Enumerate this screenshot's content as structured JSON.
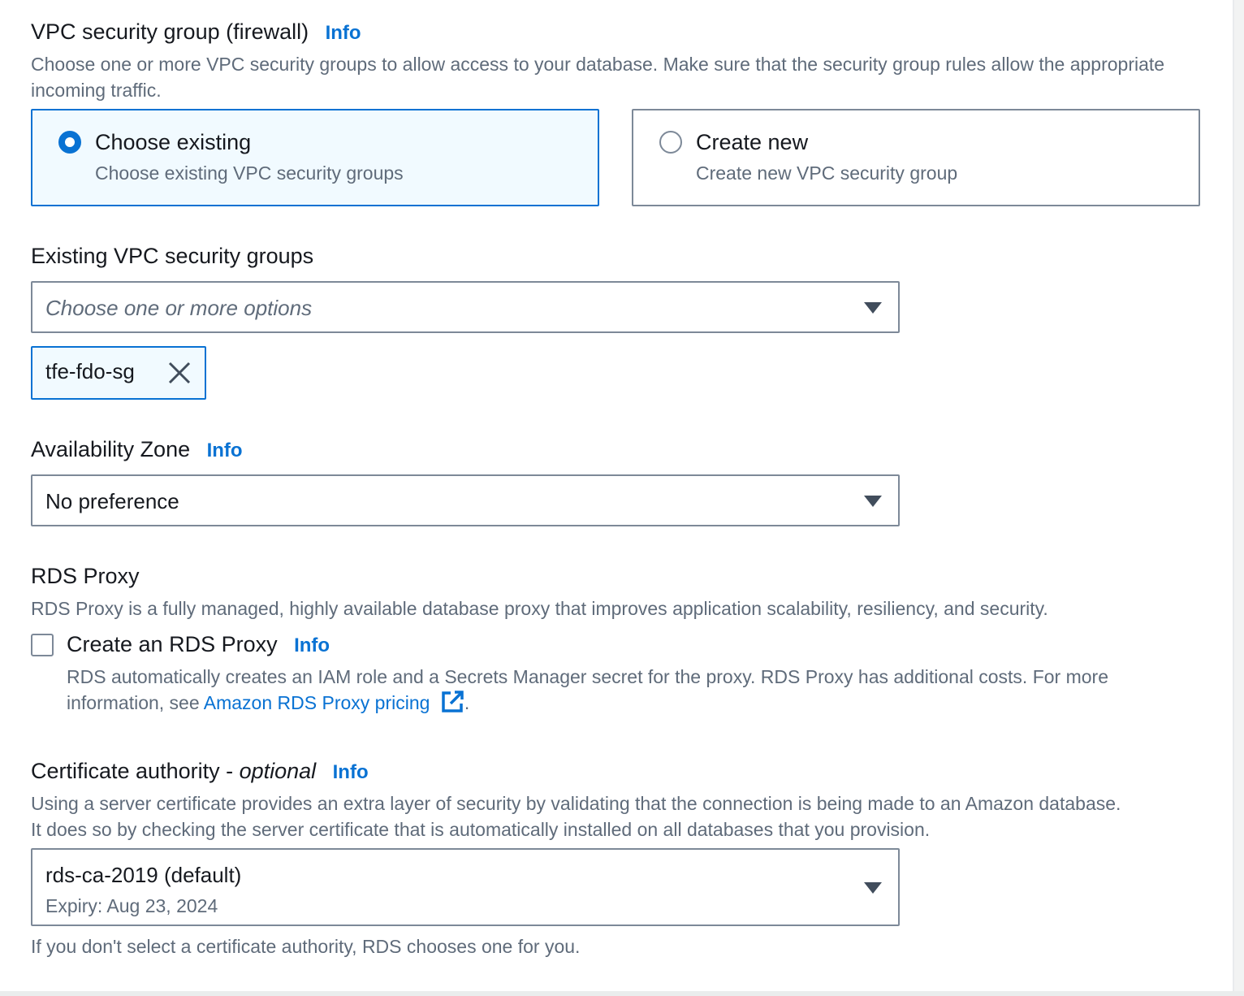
{
  "security_group": {
    "title": "VPC security group (firewall)",
    "info": "Info",
    "description": "Choose one or more VPC security groups to allow access to your database. Make sure that the security group rules allow the appropriate incoming traffic.",
    "options": [
      {
        "title": "Choose existing",
        "description": "Choose existing VPC security groups",
        "selected": true
      },
      {
        "title": "Create new",
        "description": "Create new VPC security group",
        "selected": false
      }
    ]
  },
  "existing_groups": {
    "label": "Existing VPC security groups",
    "placeholder": "Choose one or more options",
    "tokens": [
      "tfe-fdo-sg"
    ]
  },
  "availability_zone": {
    "label": "Availability Zone",
    "info": "Info",
    "value": "No preference"
  },
  "rds_proxy": {
    "title": "RDS Proxy",
    "description": "RDS Proxy is a fully managed, highly available database proxy that improves application scalability, resiliency, and security.",
    "checkbox_label": "Create an RDS Proxy",
    "info": "Info",
    "checked": false,
    "note_line1": "RDS automatically creates an IAM role and a Secrets Manager secret for the proxy. RDS Proxy has additional costs. For more",
    "note_prefix": "information, see ",
    "link_text": "Amazon RDS Proxy pricing",
    "note_suffix": "."
  },
  "certificate": {
    "label": "Certificate authority - ",
    "optional": "optional",
    "info": "Info",
    "description_line1": "Using a server certificate provides an extra layer of security by validating that the connection is being made to an Amazon database.",
    "description_line2": "It does so by checking the server certificate that is automatically installed on all databases that you provision.",
    "value": "rds-ca-2019 (default)",
    "expiry": "Expiry: Aug 23, 2024",
    "hint": "If you don't select a certificate authority, RDS chooses one for you."
  },
  "colors": {
    "accent": "#0972d3",
    "selected_bg": "#f1faff",
    "border": "#7d8998",
    "secondary_text": "#5f6b7a"
  },
  "icons": [
    "radio-icon",
    "caret-down-icon",
    "close-icon",
    "external-link-icon",
    "checkbox-icon"
  ]
}
